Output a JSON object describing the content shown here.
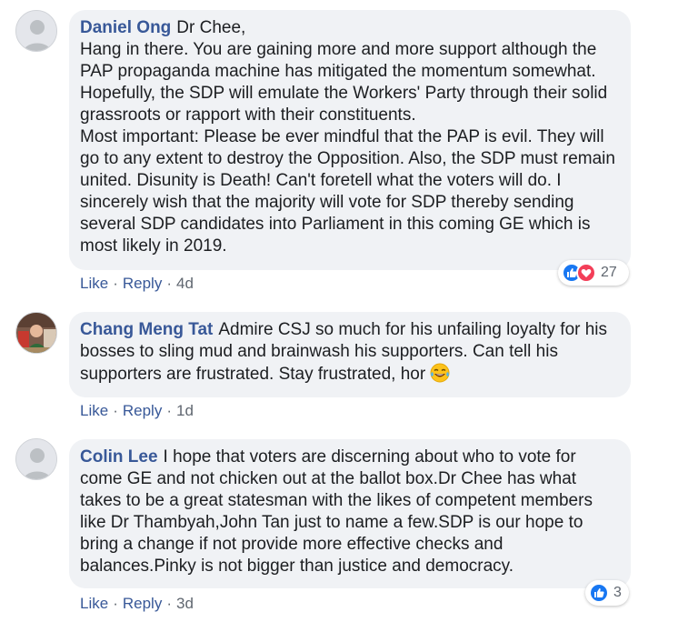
{
  "comments": [
    {
      "author": "Daniel Ong",
      "text": "Dr Chee,\nHang in there. You are gaining more and more support although the PAP propaganda machine has mitigated the momentum somewhat. Hopefully, the SDP will emulate the Workers' Party through their solid grassroots or rapport with their constituents.\nMost important: Please be ever mindful that the PAP is evil. They will go to any extent to destroy the Opposition. Also, the SDP must remain united. Disunity is Death! Can't foretell what the voters will do. I sincerely wish that the majority will vote for SDP thereby sending several SDP candidates into Parliament in this coming GE which is most likely in 2019.",
      "like_label": "Like",
      "reply_label": "Reply",
      "time": "4d",
      "reaction_count": "27",
      "avatar": "default-avatar-icon"
    },
    {
      "author": "Chang Meng Tat",
      "text": "Admire CSJ so much for his unfailing loyalty for his bosses to sling mud and brainwash his supporters. Can tell his supporters are frustrated. Stay frustrated, hor",
      "emoji": "tears-of-joy-emoji",
      "like_label": "Like",
      "reply_label": "Reply",
      "time": "1d",
      "avatar": "photo-avatar"
    },
    {
      "author": "Colin Lee",
      "text": "I hope that voters are discerning about who to vote for come GE and not chicken out at the ballot box.Dr Chee has what takes to be a great statesman with the likes of competent members like Dr Thambyah,John Tan just to name a few.SDP is our hope to bring a change if not provide more effective checks and balances.Pinky is not bigger than justice and democracy.",
      "like_label": "Like",
      "reply_label": "Reply",
      "time": "3d",
      "reaction_count": "3",
      "avatar": "default-avatar-icon"
    }
  ],
  "colors": {
    "link": "#385898",
    "bubble": "#f0f2f5",
    "meta": "#606770",
    "like": "#1877f2",
    "love": "#f33e58"
  }
}
